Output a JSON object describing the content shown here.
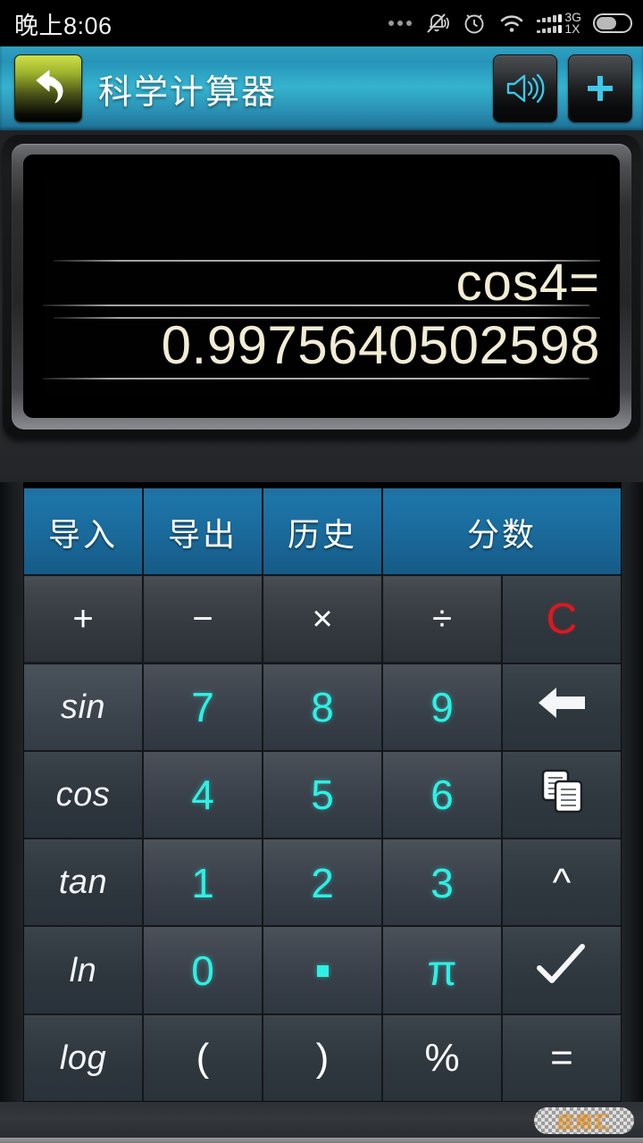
{
  "statusbar": {
    "time": "晚上8:06",
    "icons": [
      "more-dots-icon",
      "bell-muted-icon",
      "alarm-clock-icon",
      "wifi-icon",
      "signal-bars-icon",
      "battery-icon"
    ],
    "network_primary": "3G",
    "network_secondary": "1X"
  },
  "titlebar": {
    "title": "科学计算器",
    "back_icon": "back-arrow-icon",
    "actions": [
      {
        "name": "sound-button",
        "icon": "speaker-icon"
      },
      {
        "name": "add-button",
        "icon": "plus-icon"
      }
    ]
  },
  "display": {
    "expression": "cos4=",
    "result": "0.9975640502598",
    "text_color": "#f3ecd5",
    "background": "#010101"
  },
  "keypad": {
    "accent_blue": "#1d75a8",
    "accent_cyan": "#2ef0e4",
    "clear_red": "#d81a22",
    "rows": [
      [
        {
          "label": "导入",
          "name": "import-button",
          "type": "fn"
        },
        {
          "label": "导出",
          "name": "export-button",
          "type": "fn"
        },
        {
          "label": "历史",
          "name": "history-button",
          "type": "fn"
        },
        {
          "label": "分数",
          "name": "fraction-button",
          "type": "fn",
          "span": 2
        }
      ],
      [
        {
          "label": "+",
          "name": "plus-button",
          "type": "op"
        },
        {
          "label": "−",
          "name": "minus-button",
          "type": "op"
        },
        {
          "label": "×",
          "name": "multiply-button",
          "type": "op"
        },
        {
          "label": "÷",
          "name": "divide-button",
          "type": "op"
        },
        {
          "label": "C",
          "name": "clear-button",
          "type": "side-red"
        }
      ],
      [
        {
          "label": "sin",
          "name": "sin-button",
          "type": "trig-lit"
        },
        {
          "label": "7",
          "name": "digit-7-button",
          "type": "num"
        },
        {
          "label": "8",
          "name": "digit-8-button",
          "type": "num"
        },
        {
          "label": "9",
          "name": "digit-9-button",
          "type": "num"
        },
        {
          "label": "",
          "name": "backspace-button",
          "type": "icon",
          "icon": "backspace-arrow-icon"
        }
      ],
      [
        {
          "label": "cos",
          "name": "cos-button",
          "type": "trig"
        },
        {
          "label": "4",
          "name": "digit-4-button",
          "type": "num"
        },
        {
          "label": "5",
          "name": "digit-5-button",
          "type": "num"
        },
        {
          "label": "6",
          "name": "digit-6-button",
          "type": "num"
        },
        {
          "label": "",
          "name": "copy-button",
          "type": "icon",
          "icon": "copy-icon"
        }
      ],
      [
        {
          "label": "tan",
          "name": "tan-button",
          "type": "trig"
        },
        {
          "label": "1",
          "name": "digit-1-button",
          "type": "num"
        },
        {
          "label": "2",
          "name": "digit-2-button",
          "type": "num"
        },
        {
          "label": "3",
          "name": "digit-3-button",
          "type": "num"
        },
        {
          "label": "^",
          "name": "power-button",
          "type": "side"
        }
      ],
      [
        {
          "label": "ln",
          "name": "ln-button",
          "type": "trig"
        },
        {
          "label": "0",
          "name": "digit-0-button",
          "type": "num"
        },
        {
          "label": "·",
          "name": "decimal-point-button",
          "type": "dot"
        },
        {
          "label": "π",
          "name": "pi-button",
          "type": "num-sym"
        },
        {
          "label": "",
          "name": "square-root-button",
          "type": "icon",
          "icon": "check-sqrt-icon"
        }
      ],
      [
        {
          "label": "log",
          "name": "log-button",
          "type": "trig"
        },
        {
          "label": "(",
          "name": "open-paren-button",
          "type": "side"
        },
        {
          "label": ")",
          "name": "close-paren-button",
          "type": "side"
        },
        {
          "label": "%",
          "name": "percent-button",
          "type": "side"
        },
        {
          "label": "=",
          "name": "equals-button",
          "type": "side"
        }
      ]
    ]
  },
  "watermark": {
    "text": "应用汇"
  }
}
